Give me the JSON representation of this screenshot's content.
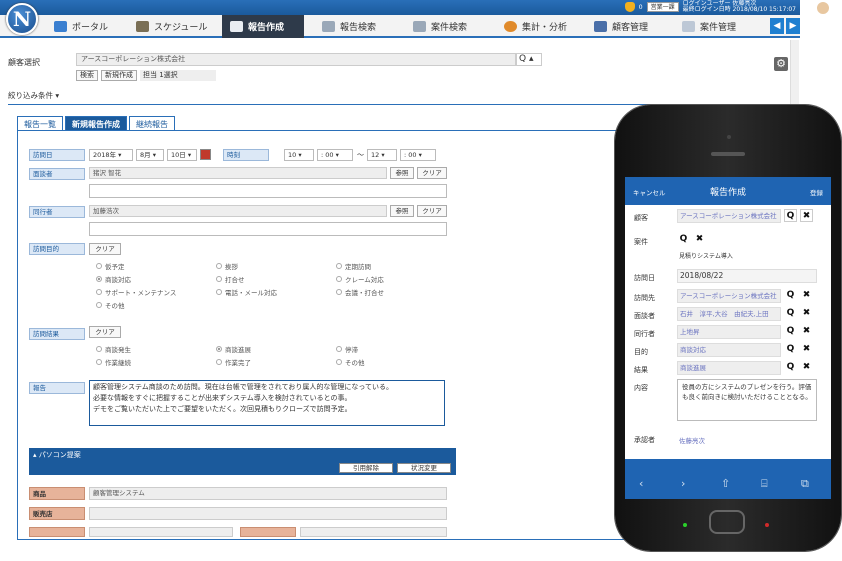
{
  "topbar": {
    "notify_count": "0",
    "selector_label": "営業一課",
    "user_line1": "ログインユーザー 佐藤亮次",
    "user_line2": "最終ログイン日時 2018/08/10 15:17:07"
  },
  "logo_letter": "N",
  "nav": {
    "items": [
      {
        "label": "ポータル"
      },
      {
        "label": "スケジュール"
      },
      {
        "label": "報告作成"
      },
      {
        "label": "報告検索"
      },
      {
        "label": "案件検索"
      },
      {
        "label": "集計・分析"
      },
      {
        "label": "顧客管理"
      },
      {
        "label": "案件管理"
      }
    ],
    "prev": "◀",
    "next": "▶"
  },
  "client": {
    "label": "顧客選択",
    "value": "アースコーポレーション株式会社",
    "search_symbol": "Q ▴",
    "btn_search": "検索",
    "btn_new": "新規作成",
    "selected_count": "担当 1選択"
  },
  "filter_label": "絞り込み条件 ▾",
  "tabs": [
    "報告一覧",
    "新規報告作成",
    "継続報告"
  ],
  "form": {
    "visit_date_label": "訪問日",
    "year": "2018年 ▾",
    "month": "8月 ▾",
    "day": "10日 ▾",
    "time_label": "時刻",
    "from_h": "10 ▾",
    "from_m": ": 00 ▾",
    "tilde": "～",
    "to_h": "12 ▾",
    "to_m": ": 00 ▾",
    "interviewer_label": "面談者",
    "interviewer_value": "猪沢 智花",
    "btn_ref": "参照",
    "btn_clear": "クリア",
    "companion_label": "同行者",
    "companion_value": "加藤浩次",
    "purpose_label": "訪問目的",
    "purpose_clear": "クリア",
    "purposes": [
      "仮予定",
      "挨拶",
      "定期訪問",
      "商談対応",
      "打合せ",
      "クレーム対応",
      "サポート・メンテナンス",
      "電話・メール対応",
      "会議・打合せ",
      "その他"
    ],
    "result_label": "訪問結果",
    "result_clear": "クリア",
    "results": [
      "商談発生",
      "商談進展",
      "停滞",
      "作業継続",
      "作業完了",
      "その他"
    ],
    "report_label": "報告",
    "report_lines": [
      "顧客管理システム商談のため訪問。現在は台帳で管理をされており属人的な管理になっている。",
      "必要な情報をすぐに把握することが出来ずシステム導入を検討されているとの事。",
      "デモをご覧いただいた上でご要望をいただく。次回見積もりクローズで訪問予定。"
    ],
    "section_title": "▴ パソコン提案",
    "btn_cite_release": "引用解除",
    "btn_status_change": "状況変更",
    "product_label": "商品",
    "product_value": "顧客管理システム",
    "dealer_label": "販売店"
  },
  "mobile": {
    "cancel": "キャンセル",
    "title": "報告作成",
    "register": "登録",
    "rows": [
      {
        "label": "顧客",
        "value": "アースコーポレーション株式会社"
      },
      {
        "label": "案件",
        "value": ""
      },
      {
        "label": "訪問日",
        "value": "2018/08/22"
      },
      {
        "label": "訪問先",
        "value": "アースコーポレーション株式会社"
      },
      {
        "label": "面談者",
        "value": "石井　淳平,大谷　由紀夫,上田"
      },
      {
        "label": "同行者",
        "value": "上地昇"
      },
      {
        "label": "目的",
        "value": "商談対応"
      },
      {
        "label": "結果",
        "value": "商談進展"
      }
    ],
    "project_value": "見積りシステム導入",
    "content_label": "内容",
    "content_text": "役員の方にシステムのプレゼンを行う。評価も良く前向きに検討いただけることとなる。",
    "approver_label": "承認者",
    "approver_value": "佐藤亮次",
    "icon_search": "Q",
    "icon_clear": "✖",
    "tab_back": "‹",
    "tab_fwd": "›",
    "tab_share": "⇧",
    "tab_book": "⌸",
    "tab_tabs": "⧉"
  }
}
